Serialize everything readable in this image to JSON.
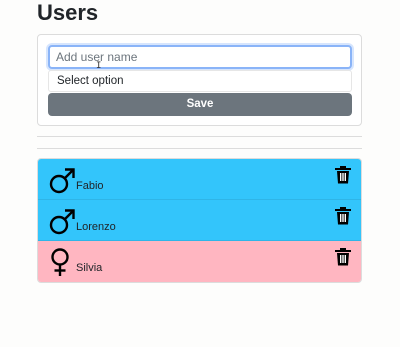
{
  "header": {
    "title": "Users"
  },
  "form": {
    "name_placeholder": "Add user name",
    "select_value": "Select option",
    "save_label": "Save",
    "cursor_glyph": "I"
  },
  "users": [
    {
      "name": "Fabio",
      "gender": "male",
      "color": "#33c5fb"
    },
    {
      "name": "Lorenzo",
      "gender": "male",
      "color": "#33c5fb"
    },
    {
      "name": "Silvia",
      "gender": "female",
      "color": "#ffb6c1"
    }
  ],
  "colors": {
    "male_bg": "#33c5fb",
    "female_bg": "#ffb6c1",
    "save_bg": "#6c757d",
    "focus_border": "#8ab4f8"
  },
  "icons": {
    "male": "male-symbol-icon",
    "female": "female-symbol-icon",
    "delete": "trash-icon"
  }
}
